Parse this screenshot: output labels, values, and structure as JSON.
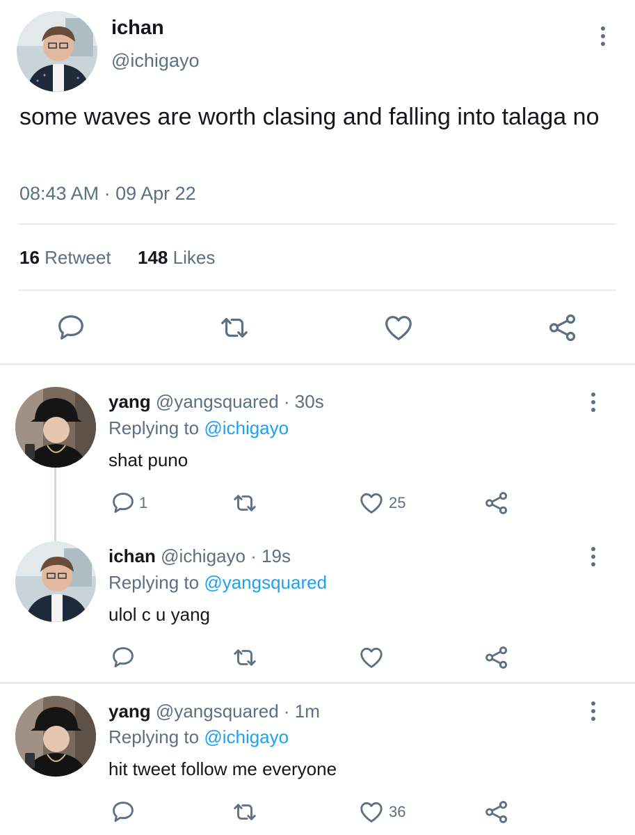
{
  "main_tweet": {
    "author_name": "ichan",
    "author_handle": "@ichigayo",
    "text": "some waves are worth clasing and falling into talaga no",
    "timestamp": "08:43 AM · 09 Apr 22",
    "retweet_count": "16",
    "retweet_label": "Retweet",
    "likes_count": "148",
    "likes_label": "Likes"
  },
  "replies": [
    {
      "name": "yang",
      "handle": "@yangsquared",
      "time": "· 30s",
      "replying_prefix": "Replying to",
      "replying_to": "@ichigayo",
      "text": "shat puno",
      "reply_count": "1",
      "retweet_count": "",
      "like_count": "25"
    },
    {
      "name": "ichan",
      "handle": "@ichigayo",
      "time": "· 19s",
      "replying_prefix": "Replying to",
      "replying_to": "@yangsquared",
      "text": "ulol c u yang",
      "reply_count": "",
      "retweet_count": "",
      "like_count": ""
    },
    {
      "name": "yang",
      "handle": "@yangsquared",
      "time": "· 1m",
      "replying_prefix": "Replying to",
      "replying_to": "@ichigayo",
      "text": "hit tweet follow me everyone",
      "reply_count": "",
      "retweet_count": "",
      "like_count": "36"
    }
  ],
  "colors": {
    "text_primary": "#14171a",
    "text_secondary": "#5b7083",
    "link": "#1da1f2",
    "divider": "#e6ecf0"
  },
  "icons": [
    "more-vertical-icon",
    "reply-icon",
    "retweet-icon",
    "like-icon",
    "share-icon"
  ]
}
